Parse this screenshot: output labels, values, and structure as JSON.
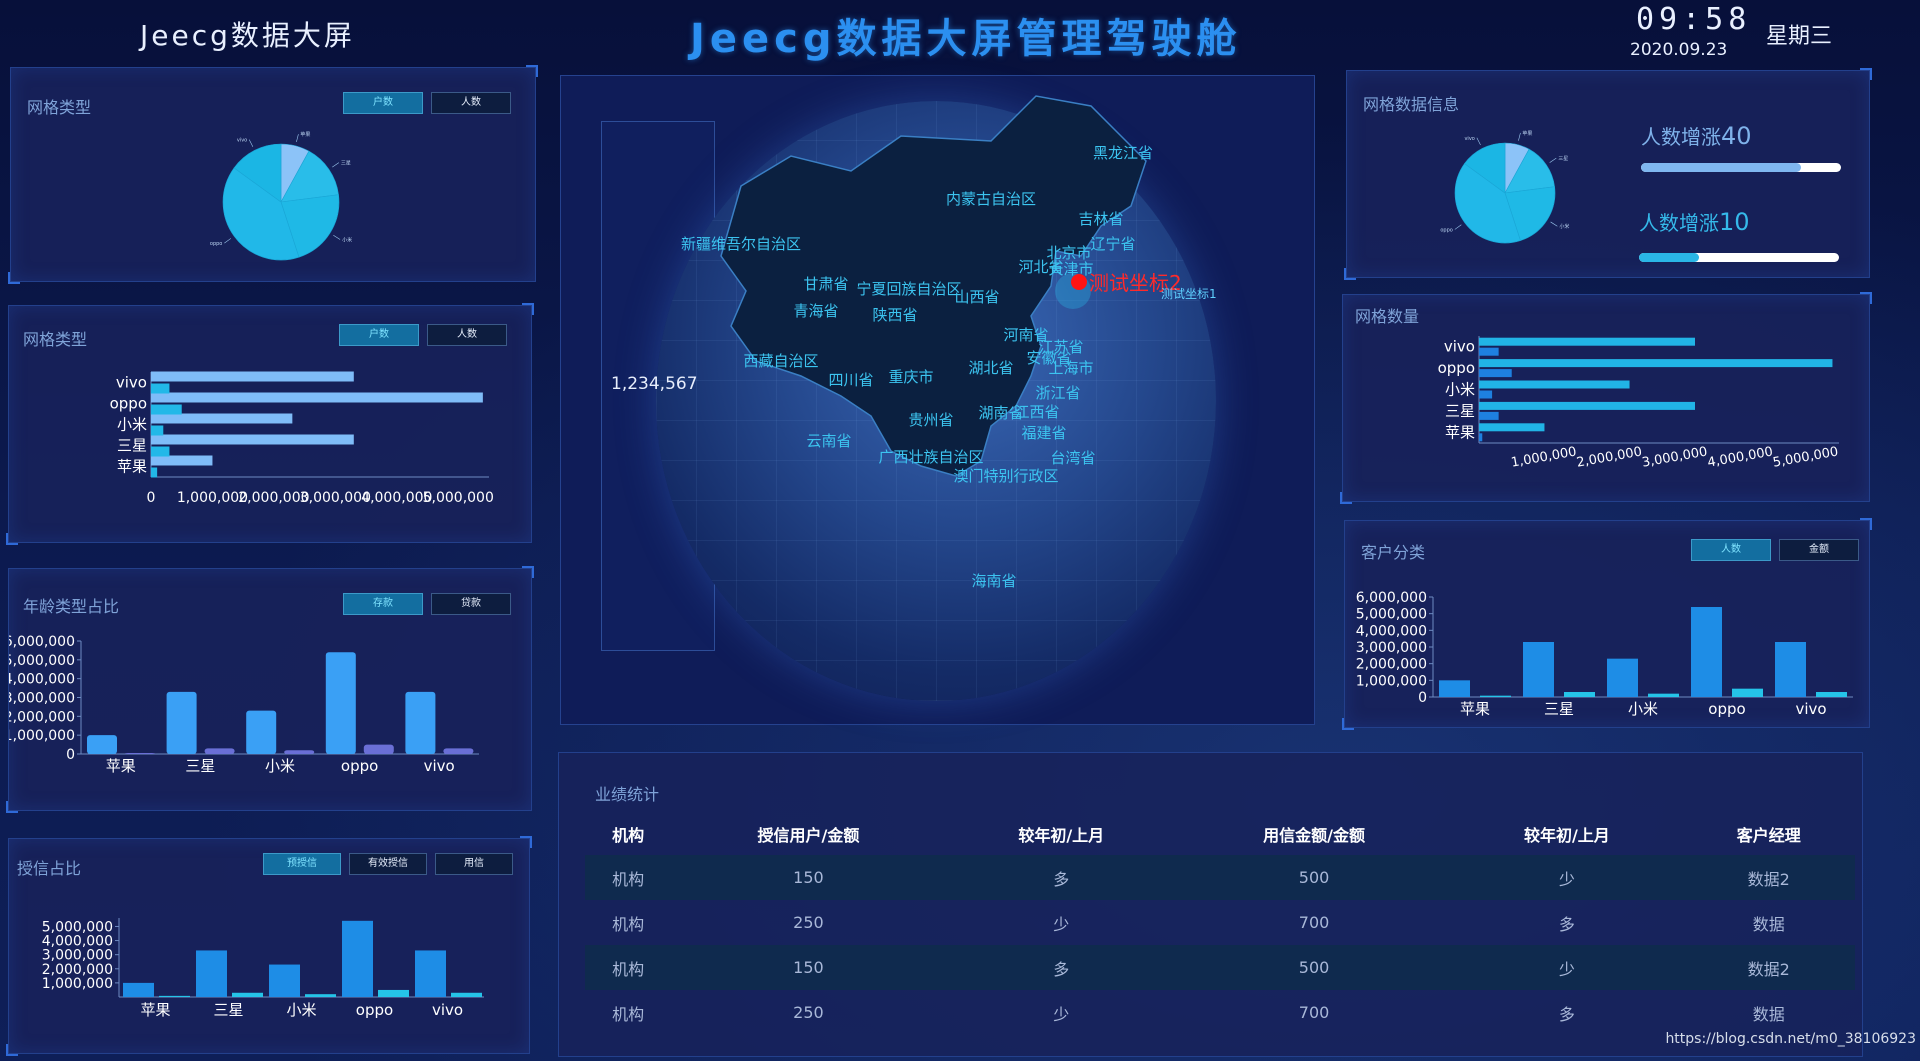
{
  "header": {
    "left_title": "Jeecg数据大屏",
    "main_title": "Jeecg数据大屏管理驾驶舱",
    "time": "09:58",
    "date": "2020.09.23",
    "weekday": "星期三"
  },
  "grid_type_pie": {
    "title": "网格类型",
    "buttons": [
      "户数",
      "人数"
    ],
    "active": 0,
    "chart_data": {
      "type": "pie",
      "labels": [
        "苹果",
        "三星",
        "小米",
        "oppo",
        "vivo"
      ],
      "values": [
        8,
        15,
        22,
        40,
        15
      ],
      "colors": [
        "#8cc3f8",
        "#29bde9",
        "#1fb9e6",
        "#21b8e8",
        "#1bb6e4"
      ]
    }
  },
  "grid_type_bar": {
    "title": "网格类型",
    "buttons": [
      "户数",
      "人数"
    ],
    "active": 0,
    "chart_data": {
      "type": "bar",
      "orientation": "horizontal",
      "categories": [
        "苹果",
        "三星",
        "小米",
        "oppo",
        "vivo"
      ],
      "series": [
        {
          "values": [
            1000000,
            3300000,
            2300000,
            5400000,
            3300000
          ],
          "color": "#7fbcf8"
        },
        {
          "values": [
            100000,
            300000,
            200000,
            500000,
            300000
          ],
          "color": "#22b8e8"
        }
      ],
      "xticks": [
        "0",
        "1,000,000",
        "2,000,000",
        "3,000,000",
        "4,000,000",
        "5,000,000"
      ],
      "xlim": [
        0,
        5500000
      ]
    }
  },
  "age_ratio": {
    "title": "年龄类型占比",
    "buttons": [
      "存款",
      "贷款"
    ],
    "active": 0,
    "chart_data": {
      "type": "bar",
      "categories": [
        "苹果",
        "三星",
        "小米",
        "oppo",
        "vivo"
      ],
      "series": [
        {
          "values": [
            1000000,
            3300000,
            2300000,
            5400000,
            3300000
          ],
          "color": "#3aa0f5"
        },
        {
          "values": [
            50000,
            300000,
            200000,
            500000,
            300000
          ],
          "color": "#6a6fd6"
        }
      ],
      "yticks": [
        "0",
        "1,000,000",
        "2,000,000",
        "3,000,000",
        "4,000,000",
        "5,000,000",
        "6,000,000"
      ],
      "ylim": [
        0,
        6000000
      ]
    }
  },
  "credit_ratio": {
    "title": "授信占比",
    "buttons": [
      "预授信",
      "有效授信",
      "用信"
    ],
    "active": 0,
    "chart_data": {
      "type": "bar",
      "categories": [
        "苹果",
        "三星",
        "小米",
        "oppo",
        "vivo"
      ],
      "series": [
        {
          "values": [
            1000000,
            3300000,
            2300000,
            5400000,
            3300000
          ],
          "color": "#1e8de6"
        },
        {
          "values": [
            80000,
            300000,
            200000,
            500000,
            300000
          ],
          "color": "#25c4e8"
        }
      ],
      "yticks": [
        "1,000,000",
        "2,000,000",
        "3,000,000",
        "4,000,000",
        "5,000,000"
      ],
      "ylim": [
        0,
        5600000
      ]
    }
  },
  "grid_info": {
    "title": "网格数据信息",
    "pie": {
      "labels": [
        "苹果",
        "三星",
        "小米",
        "oppo",
        "vivo"
      ],
      "values": [
        8,
        15,
        22,
        40,
        15
      ],
      "colors": [
        "#8cc3f8",
        "#29bde9",
        "#1fb9e6",
        "#21b8e8",
        "#1bb6e4"
      ]
    },
    "stat1_label": "人数增涨",
    "stat1_value": "40",
    "stat1_fill": 0.8,
    "stat2_label": "人数增涨",
    "stat2_value": "10",
    "stat2_fill": 0.3
  },
  "grid_count": {
    "title": "网格数量",
    "chart_data": {
      "type": "bar",
      "orientation": "horizontal",
      "categories": [
        "苹果",
        "三星",
        "小米",
        "oppo",
        "vivo"
      ],
      "series": [
        {
          "values": [
            1000000,
            3300000,
            2300000,
            5400000,
            3300000
          ],
          "color": "#21b4e6"
        },
        {
          "values": [
            50000,
            300000,
            200000,
            500000,
            300000
          ],
          "color": "#1e80e0"
        }
      ],
      "xticks": [
        "1,000,000",
        "2,000,000",
        "3,000,000",
        "4,000,000",
        "5,000,000"
      ],
      "xlim": [
        0,
        5500000
      ]
    }
  },
  "customer_class": {
    "title": "客户分类",
    "buttons": [
      "人数",
      "金额"
    ],
    "active": 0,
    "chart_data": {
      "type": "bar",
      "categories": [
        "苹果",
        "三星",
        "小米",
        "oppo",
        "vivo"
      ],
      "series": [
        {
          "values": [
            1000000,
            3300000,
            2300000,
            5400000,
            3300000
          ],
          "color": "#1e8de6"
        },
        {
          "values": [
            80000,
            300000,
            200000,
            500000,
            300000
          ],
          "color": "#25c4e8"
        }
      ],
      "yticks": [
        "0",
        "1,000,000",
        "2,000,000",
        "3,000,000",
        "4,000,000",
        "5,000,000",
        "6,000,000"
      ],
      "ylim": [
        0,
        6000000
      ]
    }
  },
  "map": {
    "value_label": "1,234,567",
    "marker_label": "测试坐标2",
    "marker_sub": "测试坐标1",
    "provinces": [
      {
        "name": "黑龙江省"
      },
      {
        "name": "内蒙古自治区"
      },
      {
        "name": "吉林省"
      },
      {
        "name": "新疆维吾尔自治区"
      },
      {
        "name": "辽宁省"
      },
      {
        "name": "北京市"
      },
      {
        "name": "天津市"
      },
      {
        "name": "河北省"
      },
      {
        "name": "甘肃省"
      },
      {
        "name": "宁夏回族自治区"
      },
      {
        "name": "青海省"
      },
      {
        "name": "陕西省"
      },
      {
        "name": "河南省"
      },
      {
        "name": "山西省"
      },
      {
        "name": "江苏省"
      },
      {
        "name": "西藏自治区"
      },
      {
        "name": "安徽省"
      },
      {
        "name": "湖北省"
      },
      {
        "name": "上海市"
      },
      {
        "name": "四川省"
      },
      {
        "name": "重庆市"
      },
      {
        "name": "浙江省"
      },
      {
        "name": "贵州省"
      },
      {
        "name": "湖南省"
      },
      {
        "name": "江西省"
      },
      {
        "name": "福建省"
      },
      {
        "name": "云南省"
      },
      {
        "name": "广西壮族自治区"
      },
      {
        "name": "台湾省"
      },
      {
        "name": "澳门特别行政区"
      },
      {
        "name": "海南省"
      }
    ]
  },
  "performance": {
    "title": "业绩统计",
    "headers": [
      "机构",
      "授信用户/金额",
      "较年初/上月",
      "用信金额/金额",
      "较年初/上月",
      "客户经理"
    ],
    "rows": [
      [
        "机构",
        "150",
        "多",
        "500",
        "少",
        "数据2"
      ],
      [
        "机构",
        "250",
        "少",
        "700",
        "多",
        "数据"
      ],
      [
        "机构",
        "150",
        "多",
        "500",
        "少",
        "数据2"
      ],
      [
        "机构",
        "250",
        "少",
        "700",
        "多",
        "数据"
      ]
    ]
  },
  "watermark": "https://blog.csdn.net/m0_38106923"
}
